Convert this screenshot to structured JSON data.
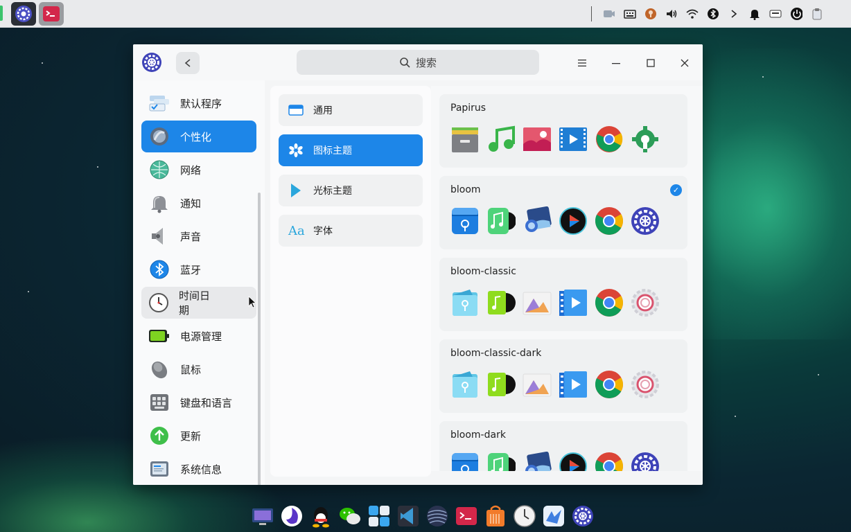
{
  "topbar": {
    "tray_icons": [
      "screen-record-icon",
      "keyboard-icon",
      "location-icon",
      "volume-icon",
      "wifi-icon",
      "bluetooth-icon",
      "chevron-right-icon",
      "notification-icon",
      "input-method-icon",
      "power-icon",
      "clipboard-icon"
    ]
  },
  "window": {
    "search_placeholder": "搜索"
  },
  "sidebar": {
    "items": [
      {
        "label": "默认程序",
        "icon": "default-apps-icon"
      },
      {
        "label": "个性化",
        "icon": "personalization-icon"
      },
      {
        "label": "网络",
        "icon": "network-icon"
      },
      {
        "label": "通知",
        "icon": "notification-icon"
      },
      {
        "label": "声音",
        "icon": "sound-icon"
      },
      {
        "label": "蓝牙",
        "icon": "bluetooth-icon"
      },
      {
        "label": "时间日期",
        "icon": "clock-icon"
      },
      {
        "label": "电源管理",
        "icon": "battery-icon"
      },
      {
        "label": "鼠标",
        "icon": "mouse-icon"
      },
      {
        "label": "键盘和语言",
        "icon": "keyboard-icon"
      },
      {
        "label": "更新",
        "icon": "update-icon"
      },
      {
        "label": "系统信息",
        "icon": "system-info-icon"
      }
    ],
    "active_index": 1,
    "hover_index": 6
  },
  "personalization": {
    "items": [
      {
        "label": "通用",
        "icon": "general-icon"
      },
      {
        "label": "图标主题",
        "icon": "icon-theme-icon"
      },
      {
        "label": "光标主题",
        "icon": "cursor-theme-icon"
      },
      {
        "label": "字体",
        "icon": "font-icon"
      }
    ],
    "active_index": 1,
    "font_icon_glyph": "Aa"
  },
  "themes": [
    {
      "name": "Papirus",
      "selected": false
    },
    {
      "name": "bloom",
      "selected": true
    },
    {
      "name": "bloom-classic",
      "selected": false
    },
    {
      "name": "bloom-classic-dark",
      "selected": false
    },
    {
      "name": "bloom-dark",
      "selected": false
    }
  ],
  "theme_preview_icons": [
    "file-manager-icon",
    "music-icon",
    "image-viewer-icon",
    "video-player-icon",
    "chrome-icon",
    "settings-icon"
  ],
  "dock": {
    "apps": [
      "multitasking-icon",
      "launcher-icon",
      "qq-icon",
      "wechat-icon",
      "app-store-icon",
      "vscode-icon",
      "browser-icon",
      "terminal-icon",
      "store-icon",
      "clock-icon",
      "deepin-app-icon",
      "settings-icon"
    ]
  }
}
